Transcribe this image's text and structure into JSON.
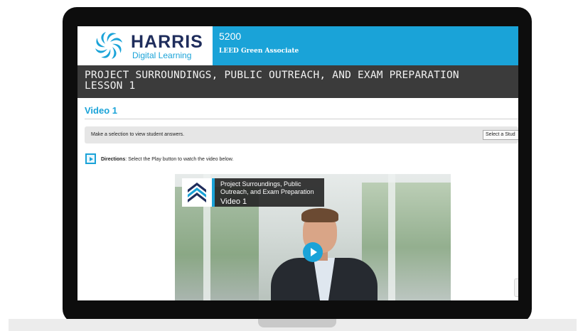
{
  "header": {
    "brand_name": "HARRIS",
    "brand_sub": "Digital Learning",
    "course_code": "5200",
    "course_name": "LEED Green Associate"
  },
  "lesson": {
    "title": "PROJECT SURROUNDINGS, PUBLIC OUTREACH, AND EXAM PREPARATION\nLESSON 1"
  },
  "section": {
    "heading": "Video 1"
  },
  "selection": {
    "text": "Make a selection to view student answers.",
    "select_value": "Select a Stud"
  },
  "directions": {
    "label": "Directions",
    "text": ": Select the Play button to watch the video below."
  },
  "video": {
    "card_title": "Project Surroundings, Public Outreach, and Exam Preparation",
    "card_subtitle": "Video 1"
  },
  "icons": {
    "logo": "harris-pinwheel-logo",
    "directions": "play-box-icon",
    "play": "play-icon"
  },
  "colors": {
    "accent": "#1aa3d8",
    "lesson_bar": "#3b3b3b",
    "brand_navy": "#1f2d5c"
  }
}
